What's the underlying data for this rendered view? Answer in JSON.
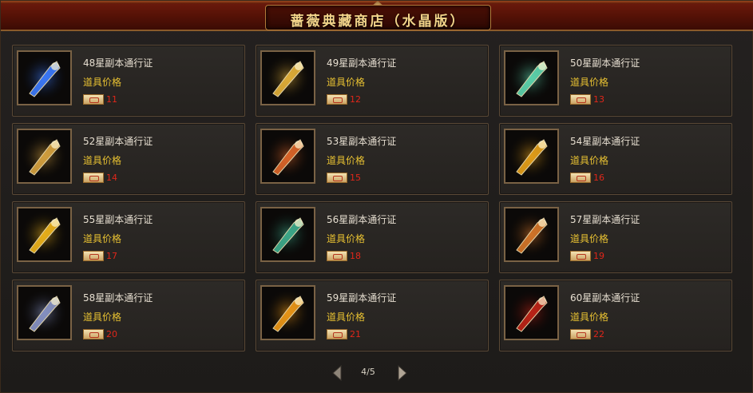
{
  "window": {
    "title": "蔷薇典藏商店（水晶版）"
  },
  "colors": {
    "price": "#e0261a",
    "price_label": "#e8c132",
    "title": "#f3d48a"
  },
  "items": [
    {
      "name": "48星副本通行证",
      "price_label": "道具价格",
      "price": "11",
      "icon": "blue-crystal-mace-icon",
      "color": "#3d7cff"
    },
    {
      "name": "49星副本通行证",
      "price_label": "道具价格",
      "price": "12",
      "icon": "gold-feather-icon",
      "color": "#e6b33a"
    },
    {
      "name": "50星副本通行证",
      "price_label": "道具价格",
      "price": "13",
      "icon": "green-feather-icon",
      "color": "#5fd8b0"
    },
    {
      "name": "52星副本通行证",
      "price_label": "道具价格",
      "price": "14",
      "icon": "gold-key-icon",
      "color": "#d9a440"
    },
    {
      "name": "53星副本通行证",
      "price_label": "道具价格",
      "price": "15",
      "icon": "fire-key-icon",
      "color": "#e0672a"
    },
    {
      "name": "54星副本通行证",
      "price_label": "道具价格",
      "price": "16",
      "icon": "gold-flame-horn-icon",
      "color": "#e8a21a"
    },
    {
      "name": "55星副本通行证",
      "price_label": "道具价格",
      "price": "17",
      "icon": "gold-flame-icon",
      "color": "#f0b51c"
    },
    {
      "name": "56星副本通行证",
      "price_label": "道具价格",
      "price": "18",
      "icon": "jade-blade-icon",
      "color": "#3fae8e"
    },
    {
      "name": "57星副本通行证",
      "price_label": "道具价格",
      "price": "19",
      "icon": "flame-spear-icon",
      "color": "#d8782a"
    },
    {
      "name": "58星副本通行证",
      "price_label": "道具价格",
      "price": "20",
      "icon": "dark-dagger-icon",
      "color": "#8a96c8"
    },
    {
      "name": "59星副本通行证",
      "price_label": "道具价格",
      "price": "21",
      "icon": "amber-gem-icon",
      "color": "#f09a18"
    },
    {
      "name": "60星副本通行证",
      "price_label": "道具价格",
      "price": "22",
      "icon": "red-rune-card-icon",
      "color": "#c02418"
    }
  ],
  "pagination": {
    "label": "4/5"
  }
}
